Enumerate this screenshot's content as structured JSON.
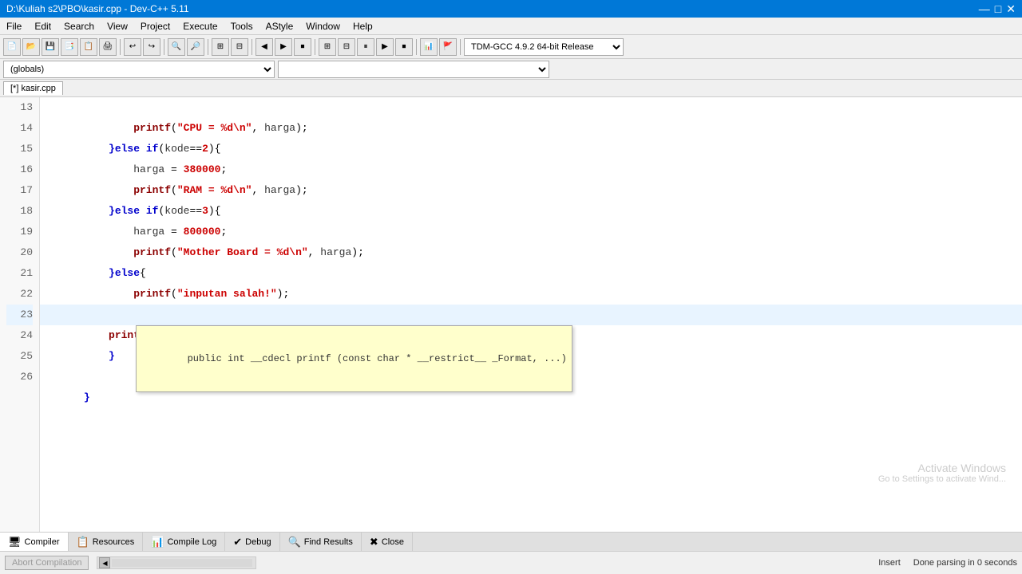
{
  "titlebar": {
    "title": "D:\\Kuliah s2\\PBO\\kasir.cpp - Dev-C++ 5.11",
    "minimize": "—",
    "maximize": "□",
    "close": "✕"
  },
  "menubar": {
    "items": [
      "File",
      "Edit",
      "Search",
      "View",
      "Project",
      "Execute",
      "Tools",
      "AStyle",
      "Window",
      "Help"
    ]
  },
  "toolbar2": {
    "dropdown1": "(globals)",
    "dropdown2": ""
  },
  "filetab": {
    "label": "[*] kasir.cpp"
  },
  "code": {
    "lines": [
      {
        "num": 13,
        "content": "        printf(\"CPU = %d\\n\", harga);"
      },
      {
        "num": 14,
        "content": "    }else if(kode==2){"
      },
      {
        "num": 15,
        "content": "        harga = 380000;"
      },
      {
        "num": 16,
        "content": "        printf(\"RAM = %d\\n\", harga);"
      },
      {
        "num": 17,
        "content": "    }else if(kode==3){"
      },
      {
        "num": 18,
        "content": "        harga = 800000;"
      },
      {
        "num": 19,
        "content": "        printf(\"Mother Board = %d\\n\", harga);"
      },
      {
        "num": 20,
        "content": "    }else{"
      },
      {
        "num": 21,
        "content": "        printf(\"inputan salah!\");"
      },
      {
        "num": 22,
        "content": "    }"
      },
      {
        "num": 23,
        "content": "    printf()|"
      },
      {
        "num": 24,
        "content": "}"
      },
      {
        "num": 25,
        "content": ""
      },
      {
        "num": 26,
        "content": "}"
      }
    ],
    "autocomplete": "public int __cdecl printf (const char * __restrict__ _Format, ...)",
    "cursor_line": 23
  },
  "bottom": {
    "tabs": [
      {
        "label": "Compiler",
        "icon": "🖥"
      },
      {
        "label": "Resources",
        "icon": "📋"
      },
      {
        "label": "Compile Log",
        "icon": "📊"
      },
      {
        "label": "Debug",
        "icon": "✔"
      },
      {
        "label": "Find Results",
        "icon": "🔍"
      },
      {
        "label": "Close",
        "icon": "✖"
      }
    ],
    "abort_button": "Abort Compilation",
    "status_insert": "Insert",
    "status_done": "Done parsing in 0 seconds",
    "activate_title": "Activate Windows",
    "activate_sub": "Go to Settings to activate Wind..."
  },
  "colors": {
    "keyword": "#0000cc",
    "string": "#cc0000",
    "number": "#cc0000",
    "highlight_line": "#e8f4ff",
    "autocomplete_bg": "#ffffcc"
  }
}
